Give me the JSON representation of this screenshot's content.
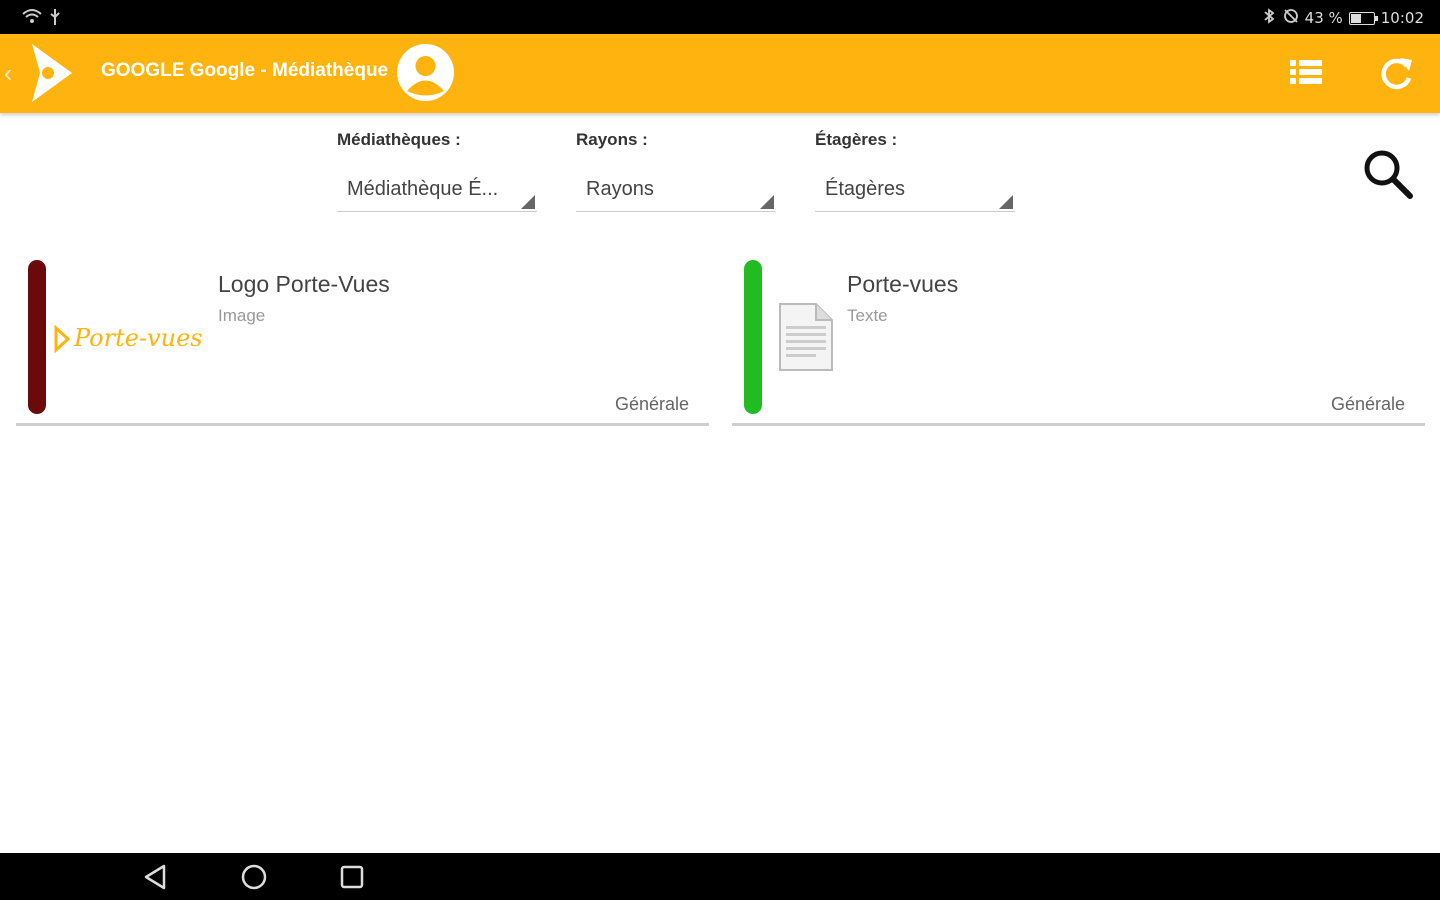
{
  "status_bar": {
    "battery_text": "43 %",
    "battery_level": 0.43,
    "time": "10:02"
  },
  "app_bar": {
    "title": "GOOGLE Google - Médiathèque",
    "colors": {
      "background": "#ffb30f",
      "foreground": "#ffffff"
    },
    "icons": [
      "back-chevron-icon",
      "app-logo-icon",
      "user-avatar-icon",
      "list-view-icon",
      "refresh-icon"
    ]
  },
  "filters": {
    "mediatheques": {
      "label": "Médiathèques :",
      "value": "Médiathèque É..."
    },
    "rayons": {
      "label": "Rayons :",
      "value": "Rayons"
    },
    "etageres": {
      "label": "Étagères :",
      "value": "Étagères"
    },
    "search_icon": "search-icon"
  },
  "items": [
    {
      "title": "Logo Porte-Vues",
      "type": "Image",
      "category": "Générale",
      "thumbnail_text": "Porte-vues",
      "accent_color": "#6b0a0a",
      "thumbnail_color": "#ffb30f"
    },
    {
      "title": "Porte-vues",
      "type": "Texte",
      "category": "Générale",
      "thumbnail_icon": "document-icon",
      "accent_color": "#22bb22"
    }
  ],
  "nav_bar": {
    "icons": [
      "nav-back-icon",
      "nav-home-icon",
      "nav-recents-icon"
    ]
  }
}
